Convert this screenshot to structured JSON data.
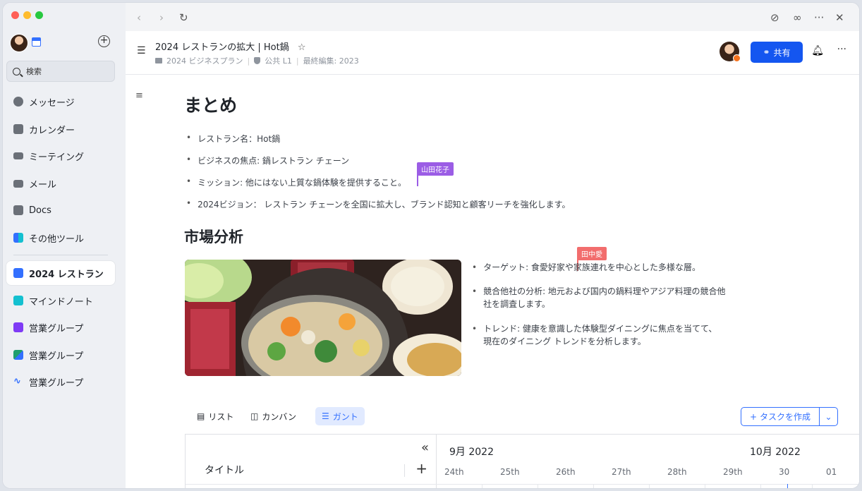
{
  "sidebar": {
    "search_label": "検索",
    "items": [
      {
        "label": "メッセージ",
        "color": "#6b7078"
      },
      {
        "label": "カレンダー",
        "color": "#6b7078"
      },
      {
        "label": "ミーテイング",
        "color": "#6b7078"
      },
      {
        "label": "メール",
        "color": "#6b7078"
      },
      {
        "label": "Docs",
        "color": "#6b7078"
      },
      {
        "label": "その他ツール",
        "color": "#3370ff"
      },
      {
        "label": "2024 レストラン",
        "color": "#3370ff"
      },
      {
        "label": "マインドノート",
        "color": "#14c0d0"
      },
      {
        "label": "営業グループ",
        "color": "#7f3bf5"
      },
      {
        "label": "営業グループ",
        "color": "#1f9e6e"
      },
      {
        "label": "営業グループ",
        "color": "#3370ff"
      }
    ]
  },
  "header": {
    "title": "2024 レストランの拡大 | Hot鍋",
    "meta_folder": "2024 ビジネスプラン",
    "meta_access": "公共 L1",
    "meta_edited": "最終編集: 2023",
    "share_label": "共有"
  },
  "doc": {
    "summary_heading": "まとめ",
    "summary_bullets": [
      "レストラン名：Hot鍋",
      "ビジネスの焦点: 鍋レストラン チェーン",
      "ミッション: 他にはない上質な鍋体験を提供すること。",
      "2024ビジョン： レストラン チェーンを全国に拡大し、ブランド認知と顧客リーチを強化します。"
    ],
    "market_heading": "市場分析",
    "market_bullets": [
      "ターゲット: 食愛好家や家族連れを中心とした多様な層。",
      "競合他社の分析: 地元および国内の鍋料理やアジア料理の競合他社を調査します。",
      "トレンド: 健康を意識した体験型ダイニングに焦点を当てて、現在のダイニング トレンドを分析します。"
    ],
    "collab_1": {
      "name": "山田花子",
      "color": "#9b5de5"
    },
    "collab_2": {
      "name": "田中愛",
      "color": "#f26d6d"
    }
  },
  "views": {
    "list": "リスト",
    "kanban": "カンバン",
    "gantt": "ガント",
    "create_task": "タスクを作成"
  },
  "gantt": {
    "title_col": "タイトル",
    "month_1": "9月 2022",
    "month_2": "10月 2022",
    "days": [
      "24th",
      "25th",
      "26th",
      "27th",
      "28th",
      "29th",
      "30",
      "01"
    ]
  }
}
